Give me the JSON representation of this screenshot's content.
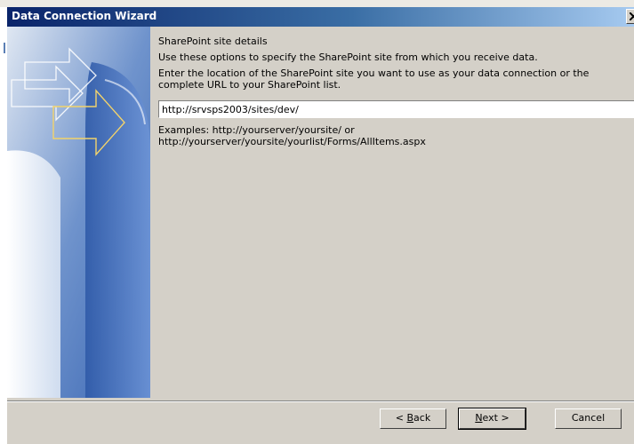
{
  "window": {
    "title": "Data Connection Wizard"
  },
  "content": {
    "heading": "SharePoint site details",
    "description": "Use these options to specify the SharePoint site from which you receive data.",
    "instruction": "Enter the location of the SharePoint site you want to use as your data connection or the complete URL to your SharePoint list.",
    "url_value": "http://srvsps2003/sites/dev/",
    "examples_line1": "Examples: http://yourserver/yoursite/ or",
    "examples_line2": "http://yourserver/yoursite/yourlist/Forms/AllItems.aspx"
  },
  "buttons": {
    "back": {
      "prefix": "< ",
      "accel": "B",
      "rest": "ack"
    },
    "next": {
      "accel": "N",
      "rest": "ext >"
    },
    "cancel": "Cancel"
  },
  "colors": {
    "titlebar_start": "#0a246a",
    "titlebar_end": "#a6caf0",
    "dialog_face": "#d4d0c8",
    "art_blue": "#3a66b3",
    "arrow_accent": "#f2d36b"
  }
}
